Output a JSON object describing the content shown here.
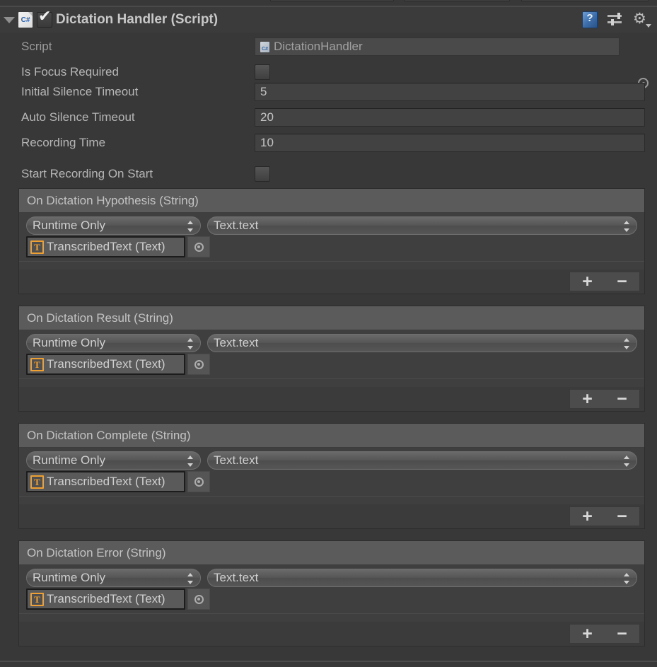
{
  "window": {
    "background": "#383838",
    "accent_orange": "#f0a030",
    "accent_blue": "#3c6ca8"
  },
  "top_partial_row": {
    "fields": [
      {
        "name": "x-field"
      },
      {
        "name": "y-field"
      },
      {
        "name": "z-field"
      }
    ]
  },
  "component_header": {
    "foldout_icon": "triangle-down-icon",
    "script_icon": "csharp-script-icon",
    "script_icon_label": "C#",
    "enabled": true,
    "title": "Dictation Handler (Script)",
    "icons": [
      {
        "name": "help-icon",
        "glyph": "?"
      },
      {
        "name": "preset-icon"
      },
      {
        "name": "gear-icon",
        "glyph": "⚙"
      }
    ]
  },
  "properties": [
    {
      "label": "Script",
      "type": "object",
      "value": "DictationHandler",
      "icon": "csharp-script-icon",
      "icon_label": "C#",
      "readonly": true
    },
    {
      "label": "Is Focus Required",
      "type": "toggle",
      "checked": false
    },
    {
      "label": "Initial Silence Timeout",
      "type": "number",
      "value": "5"
    },
    {
      "label": "Auto Silence Timeout",
      "type": "number",
      "value": "20"
    },
    {
      "label": "Recording Time",
      "type": "number",
      "value": "10"
    },
    {
      "label": "Start Recording On Start",
      "type": "toggle",
      "checked": false
    }
  ],
  "events": [
    {
      "title": "On Dictation Hypothesis (String)",
      "listener": {
        "mode": "Runtime Only",
        "function": "Text.text",
        "target_icon": "text-component-icon",
        "target_icon_label": "T",
        "target": "TranscribedText (Text)"
      },
      "add_label": "+",
      "remove_label": "−"
    },
    {
      "title": "On Dictation Result (String)",
      "listener": {
        "mode": "Runtime Only",
        "function": "Text.text",
        "target_icon": "text-component-icon",
        "target_icon_label": "T",
        "target": "TranscribedText (Text)"
      },
      "add_label": "+",
      "remove_label": "−"
    },
    {
      "title": "On Dictation Complete (String)",
      "listener": {
        "mode": "Runtime Only",
        "function": "Text.text",
        "target_icon": "text-component-icon",
        "target_icon_label": "T",
        "target": "TranscribedText (Text)"
      },
      "add_label": "+",
      "remove_label": "−"
    },
    {
      "title": "On Dictation Error (String)",
      "listener": {
        "mode": "Runtime Only",
        "function": "Text.text",
        "target_icon": "text-component-icon",
        "target_icon_label": "T",
        "target": "TranscribedText (Text)"
      },
      "add_label": "+",
      "remove_label": "−"
    }
  ]
}
